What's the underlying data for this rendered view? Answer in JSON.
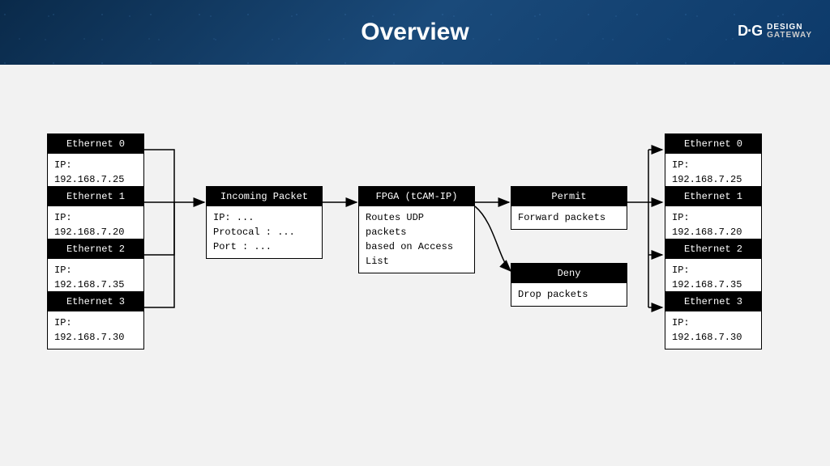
{
  "header": {
    "title": "Overview",
    "logo_mark": "D·G",
    "logo_line1": "DESIGN",
    "logo_line2": "GATEWAY"
  },
  "eth_in": [
    {
      "title": "Ethernet 0",
      "body": "IP: 192.168.7.25"
    },
    {
      "title": "Ethernet 1",
      "body": "IP: 192.168.7.20"
    },
    {
      "title": "Ethernet 2",
      "body": "IP: 192.168.7.35"
    },
    {
      "title": "Ethernet 3",
      "body": "IP: 192.168.7.30"
    }
  ],
  "eth_out": [
    {
      "title": "Ethernet 0",
      "body": "IP: 192.168.7.25"
    },
    {
      "title": "Ethernet 1",
      "body": "IP: 192.168.7.20"
    },
    {
      "title": "Ethernet 2",
      "body": "IP: 192.168.7.35"
    },
    {
      "title": "Ethernet 3",
      "body": "IP: 192.168.7.30"
    }
  ],
  "incoming": {
    "title": "Incoming Packet",
    "body": "IP: ...\nProtocal : ...\nPort : ..."
  },
  "fpga": {
    "title": "FPGA (tCAM-IP)",
    "body": "Routes UDP packets\nbased on Access\nList"
  },
  "permit": {
    "title": "Permit",
    "body": "Forward packets"
  },
  "deny": {
    "title": "Deny",
    "body": "Drop packets"
  }
}
